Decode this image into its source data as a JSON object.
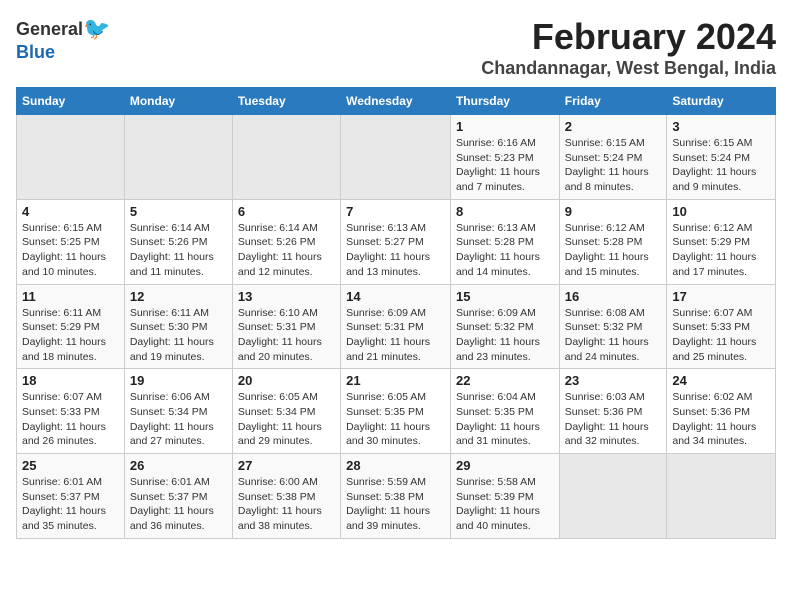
{
  "logo": {
    "general": "General",
    "blue": "Blue"
  },
  "title": "February 2024",
  "location": "Chandannagar, West Bengal, India",
  "days_of_week": [
    "Sunday",
    "Monday",
    "Tuesday",
    "Wednesday",
    "Thursday",
    "Friday",
    "Saturday"
  ],
  "weeks": [
    [
      {
        "day": "",
        "info": ""
      },
      {
        "day": "",
        "info": ""
      },
      {
        "day": "",
        "info": ""
      },
      {
        "day": "",
        "info": ""
      },
      {
        "day": "1",
        "info": "Sunrise: 6:16 AM\nSunset: 5:23 PM\nDaylight: 11 hours\nand 7 minutes."
      },
      {
        "day": "2",
        "info": "Sunrise: 6:15 AM\nSunset: 5:24 PM\nDaylight: 11 hours\nand 8 minutes."
      },
      {
        "day": "3",
        "info": "Sunrise: 6:15 AM\nSunset: 5:24 PM\nDaylight: 11 hours\nand 9 minutes."
      }
    ],
    [
      {
        "day": "4",
        "info": "Sunrise: 6:15 AM\nSunset: 5:25 PM\nDaylight: 11 hours\nand 10 minutes."
      },
      {
        "day": "5",
        "info": "Sunrise: 6:14 AM\nSunset: 5:26 PM\nDaylight: 11 hours\nand 11 minutes."
      },
      {
        "day": "6",
        "info": "Sunrise: 6:14 AM\nSunset: 5:26 PM\nDaylight: 11 hours\nand 12 minutes."
      },
      {
        "day": "7",
        "info": "Sunrise: 6:13 AM\nSunset: 5:27 PM\nDaylight: 11 hours\nand 13 minutes."
      },
      {
        "day": "8",
        "info": "Sunrise: 6:13 AM\nSunset: 5:28 PM\nDaylight: 11 hours\nand 14 minutes."
      },
      {
        "day": "9",
        "info": "Sunrise: 6:12 AM\nSunset: 5:28 PM\nDaylight: 11 hours\nand 15 minutes."
      },
      {
        "day": "10",
        "info": "Sunrise: 6:12 AM\nSunset: 5:29 PM\nDaylight: 11 hours\nand 17 minutes."
      }
    ],
    [
      {
        "day": "11",
        "info": "Sunrise: 6:11 AM\nSunset: 5:29 PM\nDaylight: 11 hours\nand 18 minutes."
      },
      {
        "day": "12",
        "info": "Sunrise: 6:11 AM\nSunset: 5:30 PM\nDaylight: 11 hours\nand 19 minutes."
      },
      {
        "day": "13",
        "info": "Sunrise: 6:10 AM\nSunset: 5:31 PM\nDaylight: 11 hours\nand 20 minutes."
      },
      {
        "day": "14",
        "info": "Sunrise: 6:09 AM\nSunset: 5:31 PM\nDaylight: 11 hours\nand 21 minutes."
      },
      {
        "day": "15",
        "info": "Sunrise: 6:09 AM\nSunset: 5:32 PM\nDaylight: 11 hours\nand 23 minutes."
      },
      {
        "day": "16",
        "info": "Sunrise: 6:08 AM\nSunset: 5:32 PM\nDaylight: 11 hours\nand 24 minutes."
      },
      {
        "day": "17",
        "info": "Sunrise: 6:07 AM\nSunset: 5:33 PM\nDaylight: 11 hours\nand 25 minutes."
      }
    ],
    [
      {
        "day": "18",
        "info": "Sunrise: 6:07 AM\nSunset: 5:33 PM\nDaylight: 11 hours\nand 26 minutes."
      },
      {
        "day": "19",
        "info": "Sunrise: 6:06 AM\nSunset: 5:34 PM\nDaylight: 11 hours\nand 27 minutes."
      },
      {
        "day": "20",
        "info": "Sunrise: 6:05 AM\nSunset: 5:34 PM\nDaylight: 11 hours\nand 29 minutes."
      },
      {
        "day": "21",
        "info": "Sunrise: 6:05 AM\nSunset: 5:35 PM\nDaylight: 11 hours\nand 30 minutes."
      },
      {
        "day": "22",
        "info": "Sunrise: 6:04 AM\nSunset: 5:35 PM\nDaylight: 11 hours\nand 31 minutes."
      },
      {
        "day": "23",
        "info": "Sunrise: 6:03 AM\nSunset: 5:36 PM\nDaylight: 11 hours\nand 32 minutes."
      },
      {
        "day": "24",
        "info": "Sunrise: 6:02 AM\nSunset: 5:36 PM\nDaylight: 11 hours\nand 34 minutes."
      }
    ],
    [
      {
        "day": "25",
        "info": "Sunrise: 6:01 AM\nSunset: 5:37 PM\nDaylight: 11 hours\nand 35 minutes."
      },
      {
        "day": "26",
        "info": "Sunrise: 6:01 AM\nSunset: 5:37 PM\nDaylight: 11 hours\nand 36 minutes."
      },
      {
        "day": "27",
        "info": "Sunrise: 6:00 AM\nSunset: 5:38 PM\nDaylight: 11 hours\nand 38 minutes."
      },
      {
        "day": "28",
        "info": "Sunrise: 5:59 AM\nSunset: 5:38 PM\nDaylight: 11 hours\nand 39 minutes."
      },
      {
        "day": "29",
        "info": "Sunrise: 5:58 AM\nSunset: 5:39 PM\nDaylight: 11 hours\nand 40 minutes."
      },
      {
        "day": "",
        "info": ""
      },
      {
        "day": "",
        "info": ""
      }
    ]
  ]
}
